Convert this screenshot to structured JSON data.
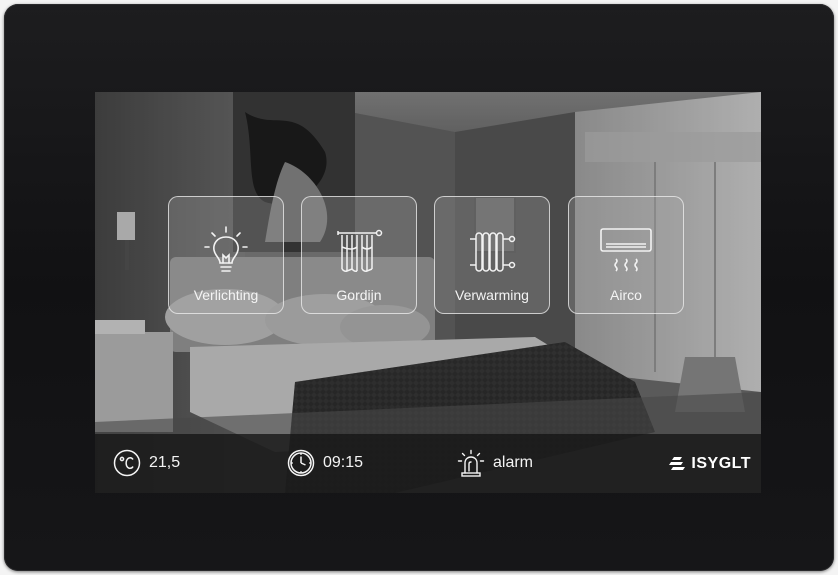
{
  "tiles": [
    {
      "label": "Verlichting",
      "icon": "lightbulb-icon"
    },
    {
      "label": "Gordijn",
      "icon": "curtain-icon"
    },
    {
      "label": "Verwarming",
      "icon": "radiator-icon"
    },
    {
      "label": "Airco",
      "icon": "air-conditioner-icon"
    }
  ],
  "status": {
    "temperature": "21,5",
    "temperature_icon": "celsius-icon",
    "time": "09:15",
    "time_icon": "clock-icon",
    "alarm": "alarm",
    "alarm_icon": "alarm-siren-icon"
  },
  "brand": {
    "name": "ISYGLT",
    "logo_icon": "isyglt-logo-icon"
  },
  "colors": {
    "bezel": "#141416",
    "tile_border": "#f0f0f0",
    "status_bar": "#141414",
    "text": "#f4f4f4"
  }
}
